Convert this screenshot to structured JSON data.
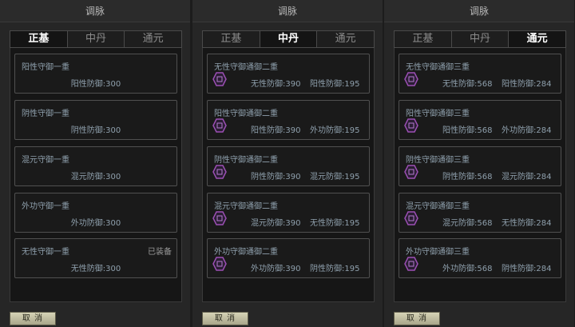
{
  "panels": [
    {
      "title": "调脉",
      "tabs": [
        "正基",
        "中丹",
        "通元"
      ],
      "active_tab": 0,
      "cards": [
        {
          "name": "阳性守御一重",
          "status": "",
          "stats": [
            "阳性防御:300"
          ]
        },
        {
          "name": "阴性守御一重",
          "status": "",
          "stats": [
            "阴性防御:300"
          ]
        },
        {
          "name": "混元守御一重",
          "status": "",
          "stats": [
            "混元防御:300"
          ]
        },
        {
          "name": "外功守御一重",
          "status": "",
          "stats": [
            "外功防御:300"
          ]
        },
        {
          "name": "无性守御一重",
          "status": "已装备",
          "stats": [
            "无性防御:300"
          ]
        }
      ],
      "cancel_label": "取 消"
    },
    {
      "title": "调脉",
      "tabs": [
        "正基",
        "中丹",
        "通元"
      ],
      "active_tab": 1,
      "cards": [
        {
          "name": "无性守御通御二重",
          "status": "",
          "stats": [
            "无性防御:390",
            "阳性防御:195"
          ]
        },
        {
          "name": "阳性守御通御二重",
          "status": "",
          "stats": [
            "阳性防御:390",
            "外功防御:195"
          ]
        },
        {
          "name": "阴性守御通御二重",
          "status": "",
          "stats": [
            "阴性防御:390",
            "混元防御:195"
          ]
        },
        {
          "name": "混元守御通御二重",
          "status": "",
          "stats": [
            "混元防御:390",
            "无性防御:195"
          ]
        },
        {
          "name": "外功守御通御二重",
          "status": "",
          "stats": [
            "外功防御:390",
            "阴性防御:195"
          ]
        }
      ],
      "cancel_label": "取 消"
    },
    {
      "title": "调脉",
      "tabs": [
        "正基",
        "中丹",
        "通元"
      ],
      "active_tab": 2,
      "cards": [
        {
          "name": "无性守御通御三重",
          "status": "",
          "stats": [
            "无性防御:568",
            "阳性防御:284"
          ]
        },
        {
          "name": "阳性守御通御三重",
          "status": "",
          "stats": [
            "阳性防御:568",
            "外功防御:284"
          ]
        },
        {
          "name": "阴性守御通御三重",
          "status": "",
          "stats": [
            "阴性防御:568",
            "混元防御:284"
          ]
        },
        {
          "name": "混元守御通御三重",
          "status": "",
          "stats": [
            "混元防御:568",
            "无性防御:284"
          ]
        },
        {
          "name": "外功守御通御三重",
          "status": "",
          "stats": [
            "外功防御:568",
            "阴性防御:284"
          ]
        }
      ],
      "cancel_label": "取 消"
    }
  ],
  "gem_icon": "purple-hexagon-gem-icon",
  "colors": {
    "gem": "#9c4fb5",
    "text_accent": "#8fa0ad",
    "button": "#c9c6aa"
  }
}
